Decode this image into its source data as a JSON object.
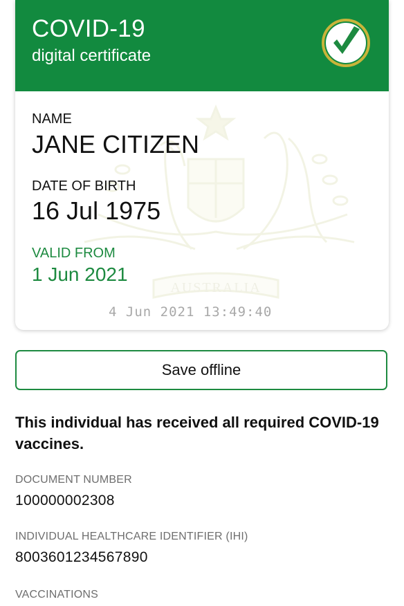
{
  "certificate": {
    "title": "COVID-19",
    "subtitle": "digital certificate",
    "name_label": "NAME",
    "name_value": "JANE CITIZEN",
    "dob_label": "DATE OF BIRTH",
    "dob_value": "16 Jul 1975",
    "valid_label": "VALID FROM",
    "valid_value": "1 Jun 2021",
    "timestamp": "4 Jun 2021 13:49:40",
    "crest_text": "AUSTRALIA",
    "header_color": "#128a3f",
    "accent_color": "#1d8a40",
    "badge_icon": "check-circle-icon"
  },
  "actions": {
    "save_label": "Save offline"
  },
  "status": {
    "message": "This individual has received all required COVID-19 vaccines."
  },
  "details": {
    "document_number_label": "DOCUMENT NUMBER",
    "document_number_value": "100000002308",
    "ihi_label": "INDIVIDUAL HEALTHCARE IDENTIFIER (IHI)",
    "ihi_value": "8003601234567890",
    "vaccinations_label": "VACCINATIONS"
  }
}
